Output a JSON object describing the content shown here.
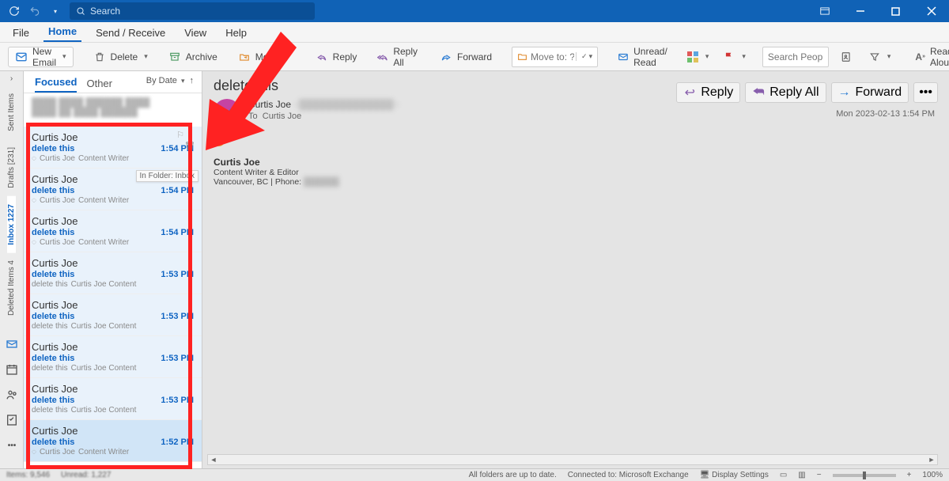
{
  "titlebar": {
    "search_placeholder": "Search"
  },
  "menu": {
    "file": "File",
    "home": "Home",
    "sendreceive": "Send / Receive",
    "view": "View",
    "help": "Help"
  },
  "ribbon": {
    "new_email": "New Email",
    "delete": "Delete",
    "archive": "Archive",
    "move": "Move",
    "reply": "Reply",
    "reply_all": "Reply All",
    "forward": "Forward",
    "move_to_placeholder": "Move to: ?",
    "unread_read": "Unread/ Read",
    "search_people_placeholder": "Search People",
    "read_aloud": "Read Aloud"
  },
  "vtabs": {
    "sent": "Sent Items",
    "drafts": "Drafts [231]",
    "inbox": "Inbox 1227",
    "deleted": "Deleted Items 4"
  },
  "list": {
    "tab_focused": "Focused",
    "tab_other": "Other",
    "sort_label": "By Date",
    "folder_tip": "In Folder: Inbox",
    "messages": [
      {
        "from": "Curtis Joe",
        "subject": "delete this",
        "time": "1:54 PM",
        "preview_a": "Curtis Joe",
        "preview_b": "Content Writer",
        "icon": true,
        "hover": true
      },
      {
        "from": "Curtis Joe",
        "subject": "delete this",
        "time": "1:54 PM",
        "preview_a": "Curtis Joe",
        "preview_b": "Content Writer",
        "icon": true
      },
      {
        "from": "Curtis Joe",
        "subject": "delete this",
        "time": "1:54 PM",
        "preview_a": "Curtis Joe",
        "preview_b": "Content Writer",
        "icon": true
      },
      {
        "from": "Curtis Joe",
        "subject": "delete this",
        "time": "1:53 PM",
        "preview_a": "delete this",
        "preview_b": "Curtis Joe   Content"
      },
      {
        "from": "Curtis Joe",
        "subject": "delete this",
        "time": "1:53 PM",
        "preview_a": "delete this",
        "preview_b": "Curtis Joe   Content"
      },
      {
        "from": "Curtis Joe",
        "subject": "delete this",
        "time": "1:53 PM",
        "preview_a": "delete this",
        "preview_b": "Curtis Joe   Content"
      },
      {
        "from": "Curtis Joe",
        "subject": "delete this",
        "time": "1:53 PM",
        "preview_a": "delete this",
        "preview_b": "Curtis Joe   Content"
      },
      {
        "from": "Curtis Joe",
        "subject": "delete this",
        "time": "1:52 PM",
        "preview_a": "Curtis Joe",
        "preview_b": "Content Writer",
        "icon": true,
        "selected": true
      }
    ]
  },
  "reading": {
    "subject": "delete this",
    "from_name": "Curtis Joe",
    "to_label": "To",
    "to_name": "Curtis Joe",
    "btn_reply": "Reply",
    "btn_reply_all": "Reply All",
    "btn_forward": "Forward",
    "timestamp": "Mon 2023-02-13 1:54 PM",
    "sig_name": "Curtis Joe",
    "sig_title": "Content Writer & Editor",
    "sig_loc": "Vancouver, BC | Phone:"
  },
  "status": {
    "items": "Items: 9,546",
    "unread": "Unread: 1,227",
    "uptodate": "All folders are up to date.",
    "connected": "Connected to: Microsoft Exchange",
    "display": "Display Settings",
    "zoom": "100%"
  }
}
